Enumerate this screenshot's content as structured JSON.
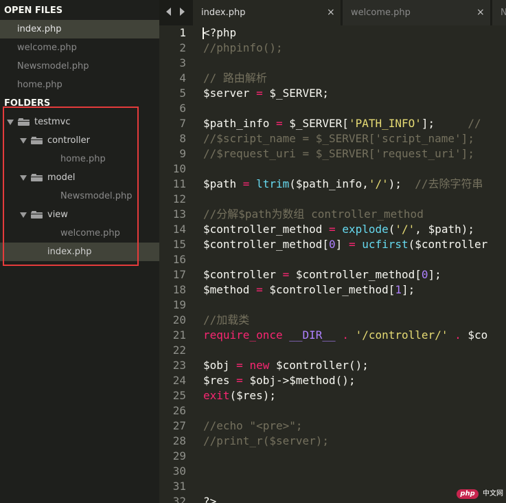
{
  "sidebar": {
    "open_files_heading": "OPEN FILES",
    "open_files": [
      "index.php",
      "welcome.php",
      "Newsmodel.php",
      "home.php"
    ],
    "active_open_file": "index.php",
    "folders_heading": "FOLDERS",
    "tree": [
      {
        "kind": "folder",
        "label": "testmvc",
        "depth": 0
      },
      {
        "kind": "folder",
        "label": "controller",
        "depth": 1
      },
      {
        "kind": "file",
        "label": "home.php",
        "depth": 2
      },
      {
        "kind": "folder",
        "label": "model",
        "depth": 1
      },
      {
        "kind": "file",
        "label": "Newsmodel.php",
        "depth": 2
      },
      {
        "kind": "folder",
        "label": "view",
        "depth": 1
      },
      {
        "kind": "file",
        "label": "welcome.php",
        "depth": 2
      },
      {
        "kind": "file",
        "label": "index.php",
        "depth": 1,
        "selected": true
      }
    ]
  },
  "tabs": [
    {
      "label": "index.php",
      "active": true,
      "close": "×"
    },
    {
      "label": "welcome.php",
      "active": false,
      "close": "×"
    },
    {
      "label": "N",
      "active": false,
      "close": ""
    }
  ],
  "editor": {
    "current_line": 1,
    "lines": [
      [
        [
          "<?php",
          "default"
        ]
      ],
      [
        [
          "//phpinfo();",
          "comment"
        ]
      ],
      [],
      [
        [
          "// 路由解析",
          "comment"
        ]
      ],
      [
        [
          "$server ",
          "default"
        ],
        [
          "=",
          "keyword"
        ],
        [
          " $_SERVER;",
          "default"
        ]
      ],
      [],
      [
        [
          "$path_info ",
          "default"
        ],
        [
          "=",
          "keyword"
        ],
        [
          " $_SERVER[",
          "default"
        ],
        [
          "'PATH_INFO'",
          "string"
        ],
        [
          "];     ",
          "default"
        ],
        [
          "//",
          "comment"
        ]
      ],
      [
        [
          "//$script_name = $_SERVER['script_name'];",
          "comment"
        ]
      ],
      [
        [
          "//$request_uri = $_SERVER['request_uri'];",
          "comment"
        ]
      ],
      [],
      [
        [
          "$path ",
          "default"
        ],
        [
          "=",
          "keyword"
        ],
        [
          " ",
          "default"
        ],
        [
          "ltrim",
          "func"
        ],
        [
          "($path_info,",
          "default"
        ],
        [
          "'/'",
          "string"
        ],
        [
          ");  ",
          "default"
        ],
        [
          "//去除字符串",
          "comment"
        ]
      ],
      [],
      [
        [
          "//分解$path为数组 controller_method",
          "comment"
        ]
      ],
      [
        [
          "$controller_method ",
          "default"
        ],
        [
          "=",
          "keyword"
        ],
        [
          " ",
          "default"
        ],
        [
          "explode",
          "func"
        ],
        [
          "(",
          "default"
        ],
        [
          "'/'",
          "string"
        ],
        [
          ", $path);",
          "default"
        ]
      ],
      [
        [
          "$controller_method[",
          "default"
        ],
        [
          "0",
          "num"
        ],
        [
          "] ",
          "default"
        ],
        [
          "=",
          "keyword"
        ],
        [
          " ",
          "default"
        ],
        [
          "ucfirst",
          "func"
        ],
        [
          "($controller",
          "default"
        ]
      ],
      [],
      [
        [
          "$controller ",
          "default"
        ],
        [
          "=",
          "keyword"
        ],
        [
          " $controller_method[",
          "default"
        ],
        [
          "0",
          "num"
        ],
        [
          "];",
          "default"
        ]
      ],
      [
        [
          "$method ",
          "default"
        ],
        [
          "=",
          "keyword"
        ],
        [
          " $controller_method[",
          "default"
        ],
        [
          "1",
          "num"
        ],
        [
          "];",
          "default"
        ]
      ],
      [],
      [
        [
          "//加载类",
          "comment"
        ]
      ],
      [
        [
          "require_once",
          "keyword"
        ],
        [
          " ",
          "default"
        ],
        [
          "__DIR__",
          "const"
        ],
        [
          " ",
          "default"
        ],
        [
          ".",
          "keyword"
        ],
        [
          " ",
          "default"
        ],
        [
          "'/controller/'",
          "string"
        ],
        [
          " ",
          "default"
        ],
        [
          ".",
          "keyword"
        ],
        [
          " $co",
          "default"
        ]
      ],
      [],
      [
        [
          "$obj ",
          "default"
        ],
        [
          "=",
          "keyword"
        ],
        [
          " ",
          "default"
        ],
        [
          "new",
          "keyword"
        ],
        [
          " $controller();",
          "default"
        ]
      ],
      [
        [
          "$res ",
          "default"
        ],
        [
          "=",
          "keyword"
        ],
        [
          " $obj->$method();",
          "default"
        ]
      ],
      [
        [
          "exit",
          "keyword"
        ],
        [
          "($res);",
          "default"
        ]
      ],
      [],
      [
        [
          "//echo \"<pre>\";",
          "comment"
        ]
      ],
      [
        [
          "//print_r($server);",
          "comment"
        ]
      ],
      [],
      [],
      [],
      [
        [
          "?>",
          "default"
        ]
      ]
    ],
    "colors": {
      "background": "#272822",
      "comment": "#75715e",
      "keyword": "#f92672",
      "string": "#e6db74",
      "func": "#66d9ef",
      "number": "#ae81ff"
    }
  },
  "watermark": {
    "logo": "php",
    "text": "中文网"
  }
}
